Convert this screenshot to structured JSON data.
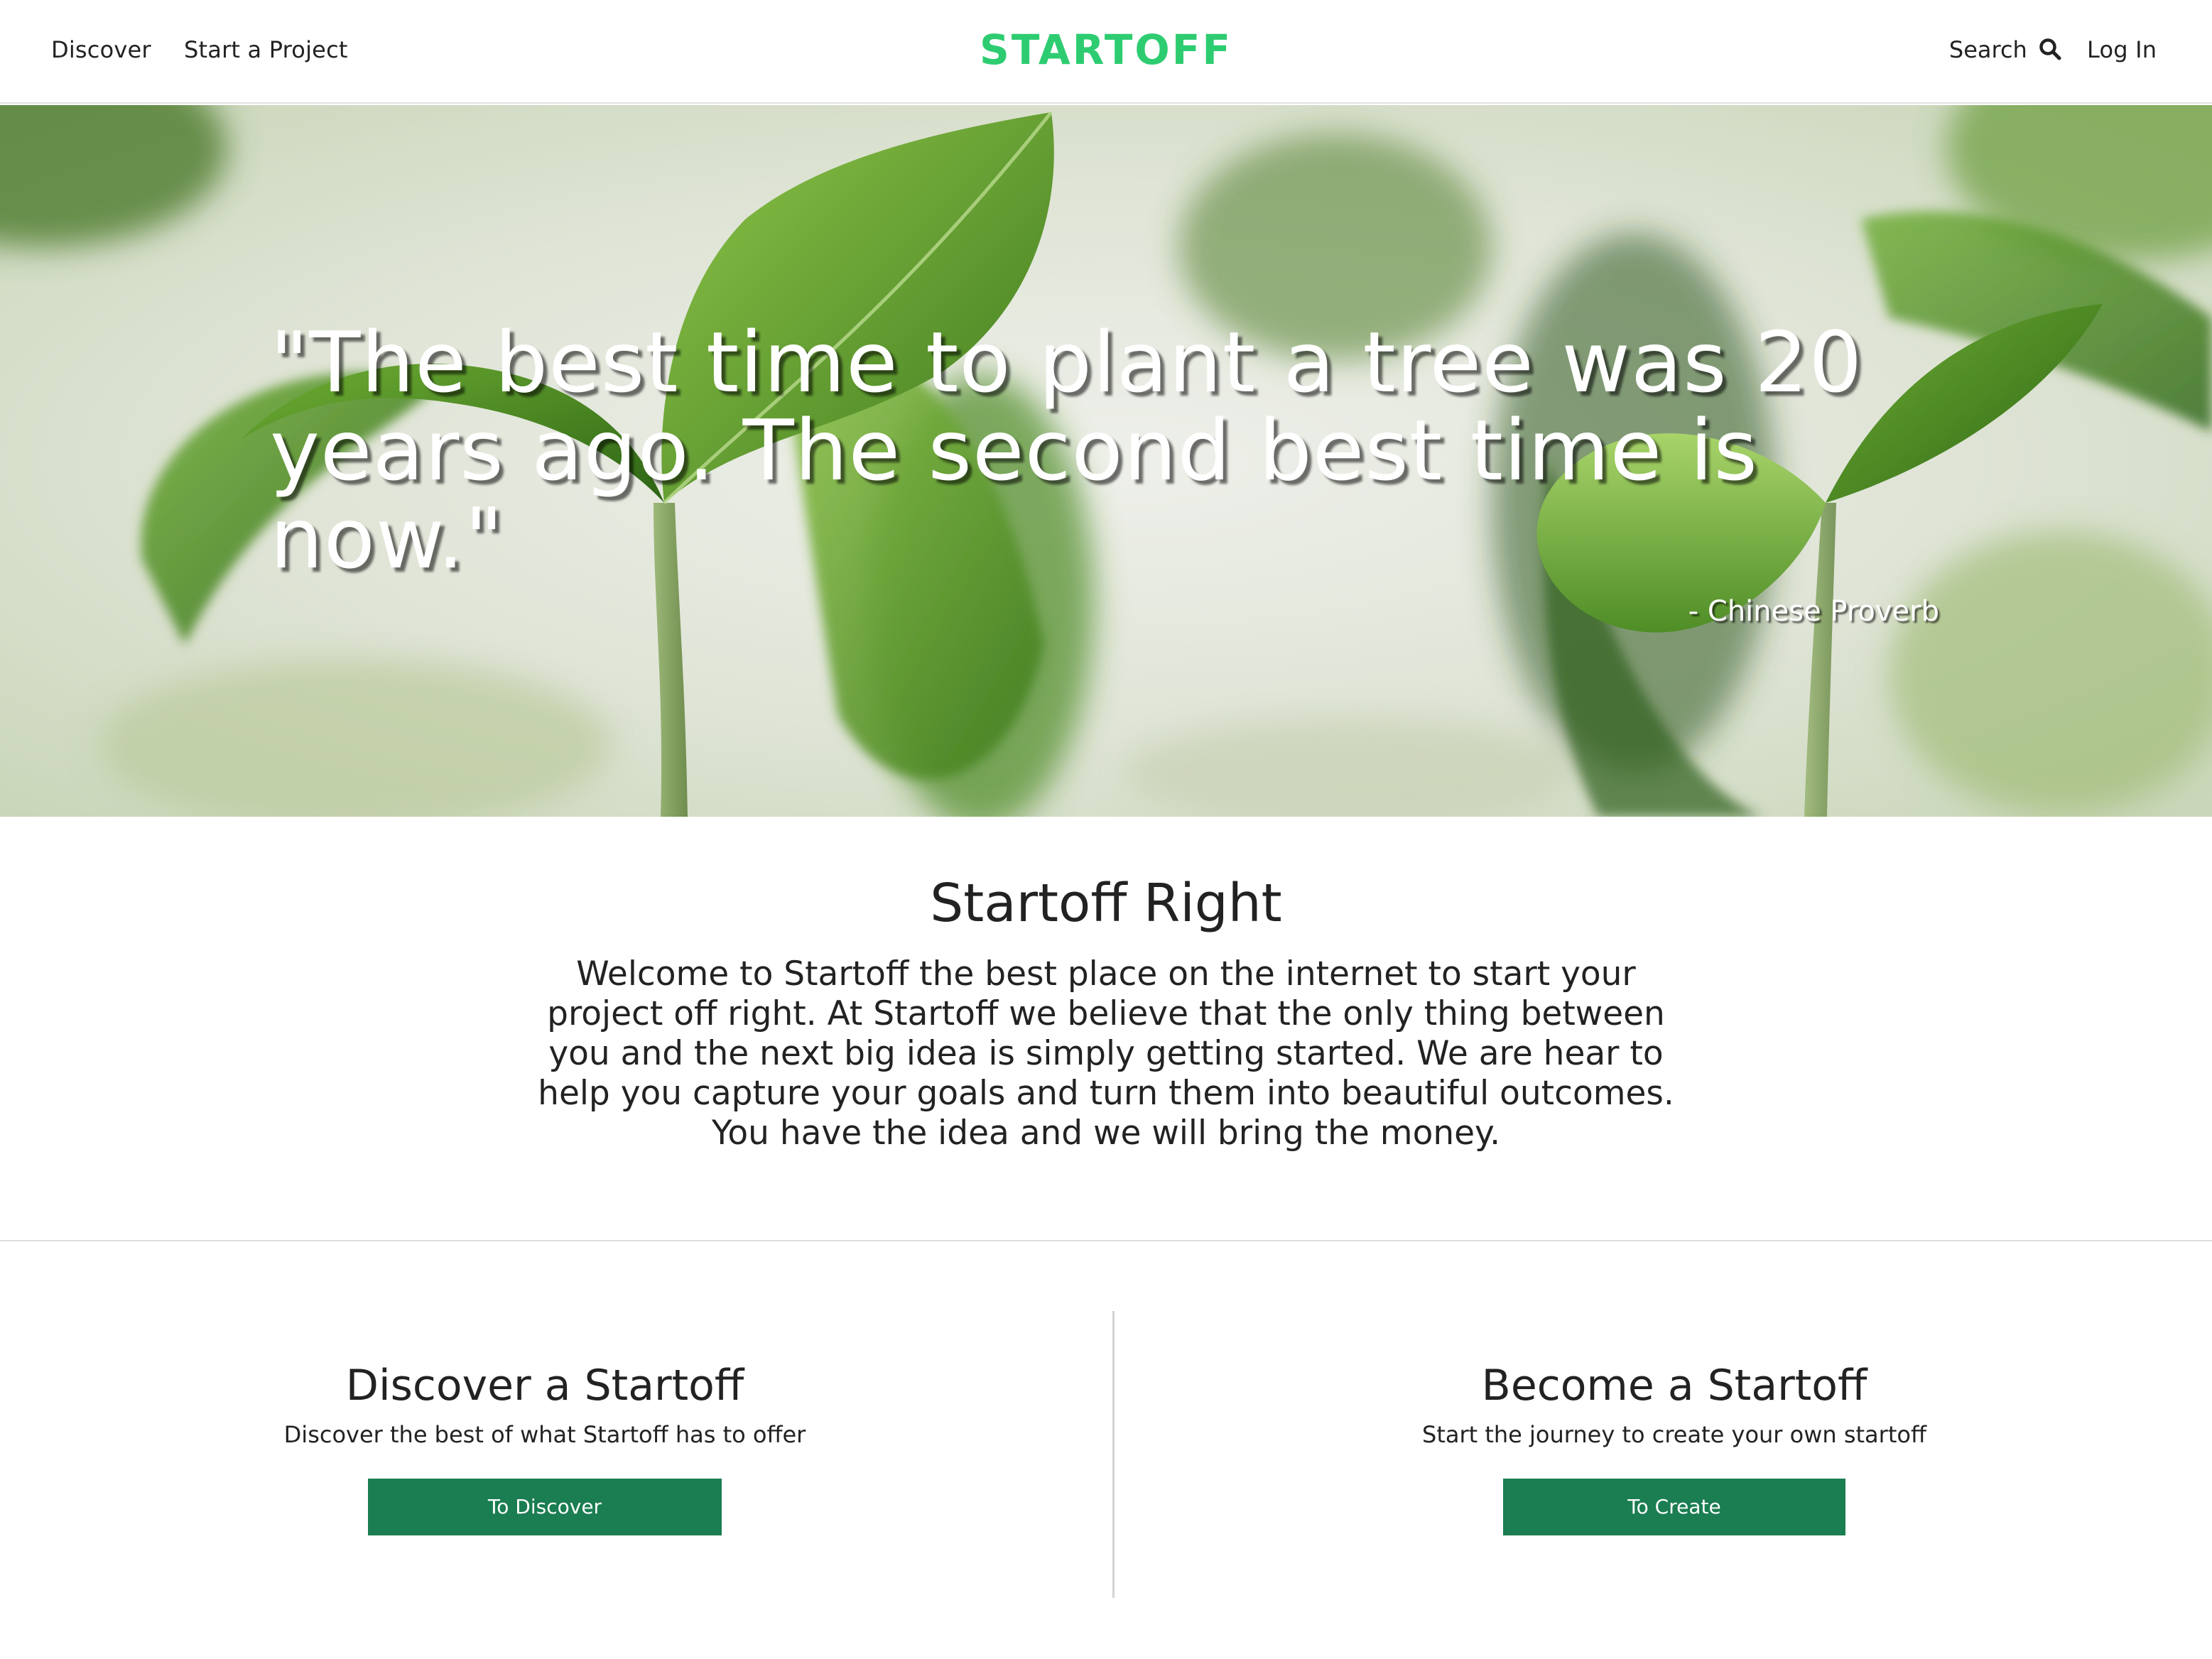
{
  "header": {
    "nav": [
      {
        "label": "Discover"
      },
      {
        "label": "Start a Project"
      }
    ],
    "logo": "STARTOFF",
    "search_label": "Search",
    "login_label": "Log In"
  },
  "hero": {
    "quote": "\"The best time to plant a tree was 20 years ago. The second best time is now.\"",
    "attribution": "- Chinese Proverb"
  },
  "intro": {
    "title": "Startoff Right",
    "text": "Welcome to Startoff the best place on the internet to start your project off right. At Startoff we believe that the only thing between you and the next big idea is simply getting started. We are hear to help you capture your goals and turn them into beautiful outcomes. You have the idea and we will bring the money."
  },
  "cta": [
    {
      "title": "Discover a Startoff",
      "subtitle": "Discover the best of what Startoff has to offer",
      "button": "To Discover"
    },
    {
      "title": "Become a Startoff",
      "subtitle": "Start the journey to create your own startoff",
      "button": "To Create"
    }
  ],
  "colors": {
    "logo": "#2ecc71",
    "button": "#1b7d52",
    "text": "#222222"
  },
  "icons": {
    "search": "search-icon"
  }
}
